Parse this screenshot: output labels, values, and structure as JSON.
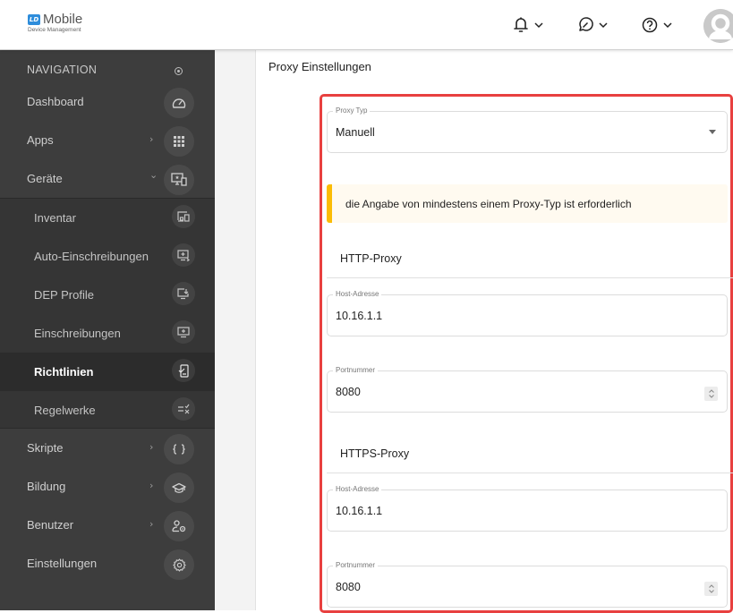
{
  "header": {
    "logo": {
      "badge": "LD",
      "title": "Mobile",
      "subtitle": "Device Management"
    },
    "actions": [
      {
        "name": "notifications",
        "icon": "bell-icon"
      },
      {
        "name": "messages",
        "icon": "compass-chat-icon"
      },
      {
        "name": "help",
        "icon": "question-circle-icon"
      }
    ],
    "avatar": "user-avatar"
  },
  "sidebar": {
    "header": "NAVIGATION",
    "items": [
      {
        "label": "Dashboard",
        "icon": "gauge-icon",
        "chevron": ""
      },
      {
        "label": "Apps",
        "icon": "grid-icon",
        "chevron": "›"
      },
      {
        "label": "Geräte",
        "icon": "devices-icon",
        "chevron": "⌄"
      },
      {
        "label": "Skripte",
        "icon": "braces-icon",
        "chevron": "›"
      },
      {
        "label": "Bildung",
        "icon": "graduation-cap-icon",
        "chevron": "›"
      },
      {
        "label": "Benutzer",
        "icon": "user-gear-icon",
        "chevron": "›"
      },
      {
        "label": "Einstellungen",
        "icon": "gear-icon",
        "chevron": ""
      }
    ],
    "subitems": [
      {
        "label": "Inventar",
        "icon": "inventory-icon",
        "active": false
      },
      {
        "label": "Auto-Einschreibungen",
        "icon": "auto-enroll-icon",
        "active": false
      },
      {
        "label": "DEP Profile",
        "icon": "dep-profile-icon",
        "active": false
      },
      {
        "label": "Einschreibungen",
        "icon": "enrollment-icon",
        "active": false
      },
      {
        "label": "Richtlinien",
        "icon": "policy-icon",
        "active": true
      },
      {
        "label": "Regelwerke",
        "icon": "rules-icon",
        "active": false
      }
    ]
  },
  "main": {
    "title": "Proxy Einstellungen",
    "proxy_type": {
      "label": "Proxy Typ",
      "value": "Manuell"
    },
    "alert": "die Angabe von mindestens einem Proxy-Typ ist erforderlich",
    "http": {
      "heading": "HTTP-Proxy",
      "host": {
        "label": "Host-Adresse",
        "value": "10.16.1.1"
      },
      "port": {
        "label": "Portnummer",
        "value": "8080"
      }
    },
    "https": {
      "heading": "HTTPS-Proxy",
      "host": {
        "label": "Host-Adresse",
        "value": "10.16.1.1"
      },
      "port": {
        "label": "Portnummer",
        "value": "8080"
      }
    }
  },
  "colors": {
    "highlight": "#e8403f",
    "alert_bar": "#fbbc05",
    "sidebar_bg": "#3d3d3d",
    "logo_blue": "#2e8ddb"
  }
}
